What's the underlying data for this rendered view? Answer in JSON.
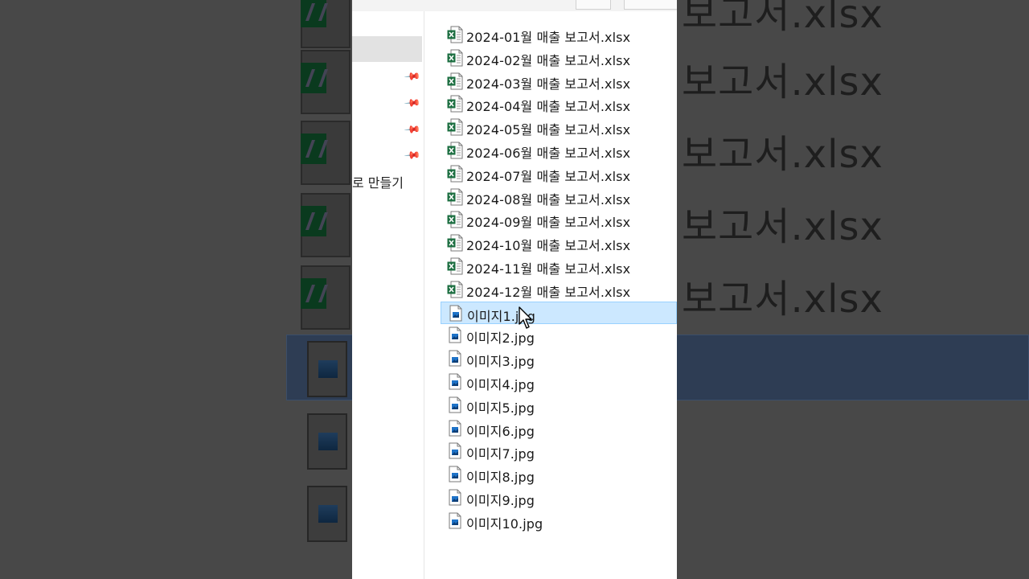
{
  "background": {
    "zoom_texts": [
      "보고서.xlsx",
      "보고서.xlsx",
      "보고서.xlsx",
      "보고서.xlsx",
      "보고서.xlsx"
    ]
  },
  "nav": {
    "create_label": "로 만들기"
  },
  "files": [
    {
      "name": "2024-01월 매출 보고서.xlsx",
      "type": "xlsx"
    },
    {
      "name": "2024-02월 매출 보고서.xlsx",
      "type": "xlsx"
    },
    {
      "name": "2024-03월 매출 보고서.xlsx",
      "type": "xlsx"
    },
    {
      "name": "2024-04월 매출 보고서.xlsx",
      "type": "xlsx"
    },
    {
      "name": "2024-05월 매출 보고서.xlsx",
      "type": "xlsx"
    },
    {
      "name": "2024-06월 매출 보고서.xlsx",
      "type": "xlsx"
    },
    {
      "name": "2024-07월 매출 보고서.xlsx",
      "type": "xlsx"
    },
    {
      "name": "2024-08월 매출 보고서.xlsx",
      "type": "xlsx"
    },
    {
      "name": "2024-09월 매출 보고서.xlsx",
      "type": "xlsx"
    },
    {
      "name": "2024-10월 매출 보고서.xlsx",
      "type": "xlsx"
    },
    {
      "name": "2024-11월 매출 보고서.xlsx",
      "type": "xlsx"
    },
    {
      "name": "2024-12월 매출 보고서.xlsx",
      "type": "xlsx"
    },
    {
      "name": "이미지1.jpg",
      "type": "jpg",
      "selected": true
    },
    {
      "name": "이미지2.jpg",
      "type": "jpg"
    },
    {
      "name": "이미지3.jpg",
      "type": "jpg"
    },
    {
      "name": "이미지4.jpg",
      "type": "jpg"
    },
    {
      "name": "이미지5.jpg",
      "type": "jpg"
    },
    {
      "name": "이미지6.jpg",
      "type": "jpg"
    },
    {
      "name": "이미지7.jpg",
      "type": "jpg"
    },
    {
      "name": "이미지8.jpg",
      "type": "jpg"
    },
    {
      "name": "이미지9.jpg",
      "type": "jpg"
    },
    {
      "name": "이미지10.jpg",
      "type": "jpg"
    }
  ],
  "colors": {
    "selection_bg": "#cce8ff",
    "selection_border": "#99d1ff",
    "excel_green": "#1d6f42",
    "image_blue": "#1e73c8"
  },
  "icons": {
    "xlsx": "excel-file-icon",
    "jpg": "image-file-icon",
    "pin": "pin-icon",
    "cursor": "mouse-pointer-icon"
  }
}
